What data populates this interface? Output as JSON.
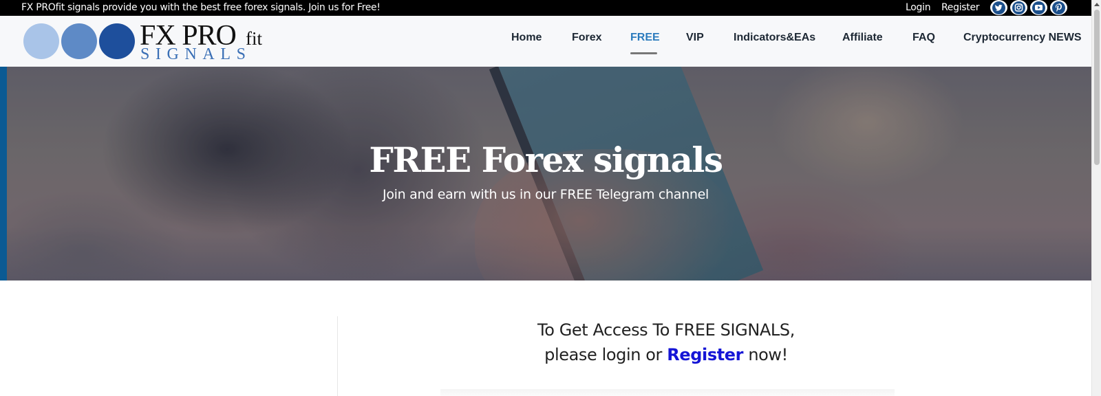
{
  "topbar": {
    "message": "FX PROfit signals provide you with the best free forex signals. Join us for Free!",
    "login": "Login",
    "register": "Register",
    "social": [
      "twitter-icon",
      "instagram-icon",
      "youtube-icon",
      "pinterest-icon"
    ]
  },
  "logo": {
    "line1": "FX PRO",
    "fit": "fit",
    "line2": "SIGNALS"
  },
  "nav": {
    "items": [
      "Home",
      "Forex",
      "FREE",
      "VIP",
      "Indicators&EAs",
      "Affiliate",
      "FAQ",
      "Cryptocurrency NEWS"
    ],
    "active": "FREE"
  },
  "hero": {
    "title": "FREE Forex signals",
    "subtitle": "Join and earn with us in our FREE Telegram channel"
  },
  "content": {
    "line1": "To Get Access To FREE SIGNALS,",
    "line2_prefix": "please login or ",
    "line2_link": "Register",
    "line2_suffix": " now!"
  },
  "colors": {
    "accent": "#2b7bbd",
    "link": "#1515d6",
    "topbar": "#000000",
    "hero_edge": "#0b5a93"
  }
}
